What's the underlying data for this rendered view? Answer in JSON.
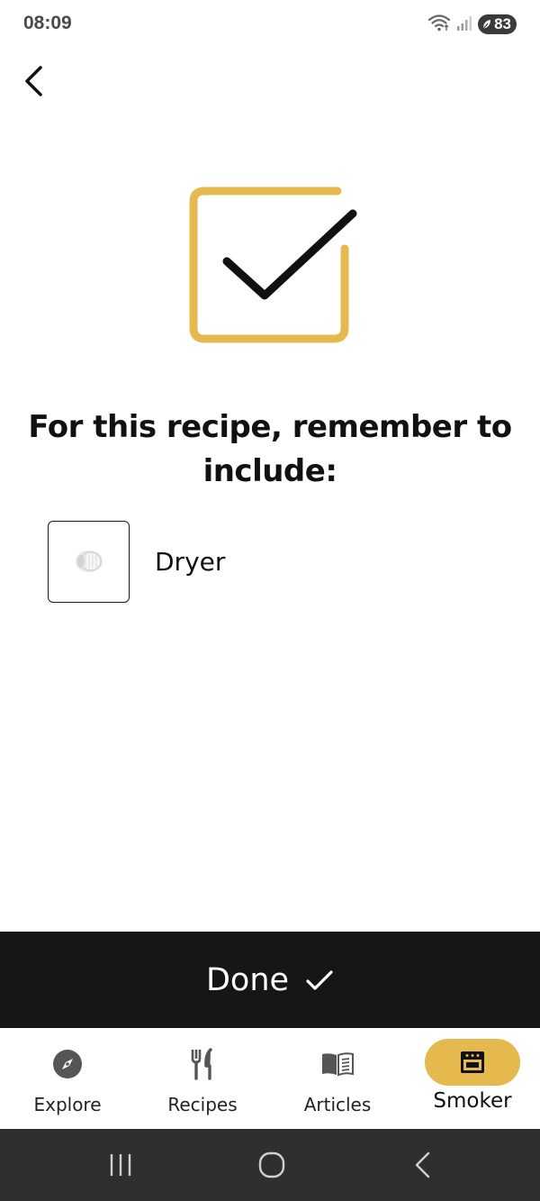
{
  "status_bar": {
    "time": "08:09",
    "battery_level": "83",
    "icons": [
      "wifi-icon",
      "signal-icon",
      "battery-icon"
    ]
  },
  "heading": "For this recipe, remember to include:",
  "items": [
    {
      "label": "Dryer",
      "icon": "dryer-accessory-image"
    }
  ],
  "done_button": {
    "label": "Done",
    "icon": "checkmark-icon"
  },
  "bottom_nav": {
    "items": [
      {
        "label": "Explore",
        "icon": "compass-icon"
      },
      {
        "label": "Recipes",
        "icon": "fork-knife-icon"
      },
      {
        "label": "Articles",
        "icon": "book-icon"
      },
      {
        "label": "Smoker",
        "icon": "smoker-icon",
        "active": true
      }
    ]
  },
  "system_nav": [
    "recent-apps-icon",
    "home-icon",
    "back-icon"
  ],
  "colors": {
    "accent": "#e6b94f",
    "button_bg": "#161616",
    "system_nav_bg": "#2f2f2f"
  }
}
